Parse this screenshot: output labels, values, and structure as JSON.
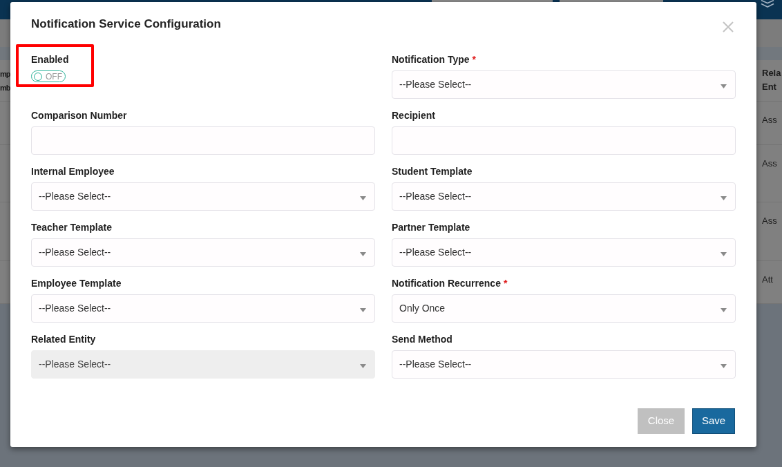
{
  "background": {
    "left_column": {
      "header_lines": [
        "mp",
        "mb"
      ]
    },
    "right_column": {
      "header_lines": [
        "Rela",
        "Ent"
      ],
      "rows": [
        "Ass",
        "Ass",
        "Ass",
        "Att"
      ]
    }
  },
  "dialog": {
    "title": "Notification Service Configuration",
    "fields": [
      {
        "kind": "toggle",
        "label": "Enabled",
        "on": false,
        "state_label": "OFF",
        "highlighted": true
      },
      {
        "kind": "select",
        "label": "Notification Type",
        "required_mark": "*",
        "value": "--Please Select--",
        "disabled": false,
        "highlighted": false
      },
      {
        "kind": "text",
        "label": "Comparison Number",
        "highlighted": false
      },
      {
        "kind": "text",
        "label": "Recipient",
        "highlighted": false
      },
      {
        "kind": "select",
        "label": "Internal Employee",
        "value": "--Please Select--",
        "disabled": false,
        "highlighted": false
      },
      {
        "kind": "select",
        "label": "Student Template",
        "value": "--Please Select--",
        "disabled": false,
        "highlighted": false
      },
      {
        "kind": "select",
        "label": "Teacher Template",
        "value": "--Please Select--",
        "disabled": false,
        "highlighted": false
      },
      {
        "kind": "select",
        "label": "Partner Template",
        "value": "--Please Select--",
        "disabled": false,
        "highlighted": false
      },
      {
        "kind": "select",
        "label": "Employee Template",
        "value": "--Please Select--",
        "disabled": false,
        "highlighted": false
      },
      {
        "kind": "select",
        "label": "Notification Recurrence",
        "required_mark": "*",
        "value": "Only Once",
        "disabled": false,
        "highlighted": false
      },
      {
        "kind": "select",
        "label": "Related Entity",
        "value": "--Please Select--",
        "disabled": true,
        "highlighted": false
      },
      {
        "kind": "select",
        "label": "Send Method",
        "value": "--Please Select--",
        "disabled": false,
        "highlighted": false
      }
    ],
    "buttons": [
      {
        "label": "Close",
        "kind": "secondary"
      },
      {
        "label": "Save",
        "kind": "primary"
      }
    ]
  }
}
